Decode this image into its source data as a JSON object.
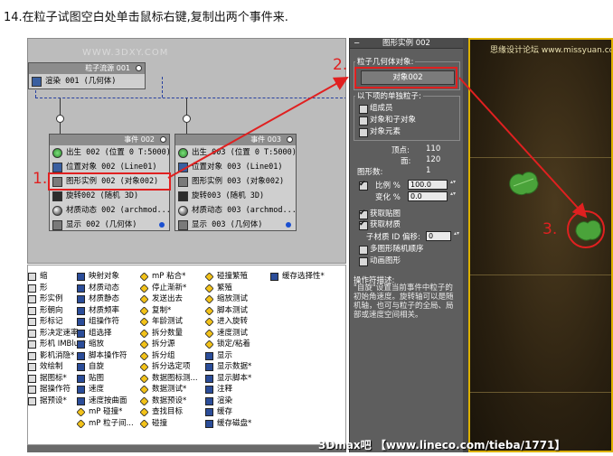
{
  "caption": "14.在粒子试图空白处单击鼠标右键,复制出两个事件来.",
  "watermark_top": "WWW.3DXY.COM",
  "source_node": {
    "title": "粒子流源 001",
    "row": "渲染 001 (几何体)"
  },
  "event_002": {
    "title": "事件 002",
    "rows": [
      "出生 002 (位置 0 T:5000)",
      "位置对象 002 (Line01)",
      "图形实例 002 (对象002)",
      "旋转002 (随机 3D)",
      "材质动态 002 (archmod...",
      "显示 002 (几何体)"
    ]
  },
  "event_003": {
    "title": "事件 003",
    "rows": [
      "出生 003 (位置 0 T:5000)",
      "位置对象 003 (Line01)",
      "图形实例 003 (对象002)",
      "旋转003 (随机 3D)",
      "材质动态 003 (archmod...",
      "显示 003 (几何体)"
    ]
  },
  "callouts": [
    "1.",
    "2.",
    "3."
  ],
  "depot": {
    "col1": [
      "缩",
      "形",
      "形实例",
      "形朝向",
      "形标记",
      "形决定速率",
      "形机 IMBlur*",
      "影机消隐*",
      "效绘制",
      "据图标*",
      "据操作符",
      "据预设*"
    ],
    "col2": [
      "映射对象",
      "材质动态",
      "材质静态",
      "材质频率",
      "组操作符",
      "组选择",
      "缩放",
      "脚本操作符",
      "自旋",
      "贴图",
      "速度",
      "速度按曲面",
      "mP 碰撞*",
      "mP 粒子间..."
    ],
    "col3": [
      "mP 粘合*",
      "停止渐新*",
      "发送出去",
      "复制*",
      "年龄测试",
      "拆分数量",
      "拆分源",
      "拆分组",
      "拆分选定项",
      "数据图标测...",
      "数据测试*",
      "数据预设*",
      "查找目标",
      "碰撞"
    ],
    "col4": [
      "碰撞繁殖",
      "繁殖",
      "缩放测试",
      "脚本测试",
      "进入旋转",
      "速度测试",
      "锁定/粘着",
      "显示",
      "显示数据*",
      "显示脚本*",
      "注释",
      "渲染",
      "缓存",
      "缓存磁盘*"
    ],
    "col5": [
      "缓存选择性*"
    ]
  },
  "panel": {
    "title": "图形实例 002",
    "group1_label": "粒子几何体对象:",
    "object_button": "对象002",
    "group2_label": "以下项的单独粒子:",
    "checks": [
      "组成员",
      "对象和子对象",
      "对象元素"
    ],
    "vertices_label": "顶点:",
    "vertices_value": "110",
    "faces_label": "面:",
    "faces_value": "120",
    "shape_count_label": "图形数:",
    "shape_count_value": "1",
    "scale_label": "比例 %",
    "scale_value": "100.0",
    "variation_label": "变化 %",
    "variation_value": "0.0",
    "get_map": "获取贴图",
    "get_material": "获取材质",
    "submat_label": "子材质 ID 偏移:",
    "submat_value": "0",
    "multi_shape": "多图形随机顺序",
    "anim_shape": "动画图形",
    "desc_label": "操作符描述:",
    "desc_text": "\"自旋\"设置当前事件中粒子的初始角速度。旋转轴可以是随机轴，也可与粒子的全局、局部或速度空间相关。"
  },
  "viewport": {
    "title": "思缘设计论坛 www.missyuan.com"
  },
  "bottom_watermark": "3Dmax吧 【www.lineco.com/tieba/1771】",
  "colors": {
    "accent_red": "#e02020",
    "viewport_border": "#dcb000",
    "node_link": "#2740a0",
    "leaf_green": "#4aa33a"
  }
}
